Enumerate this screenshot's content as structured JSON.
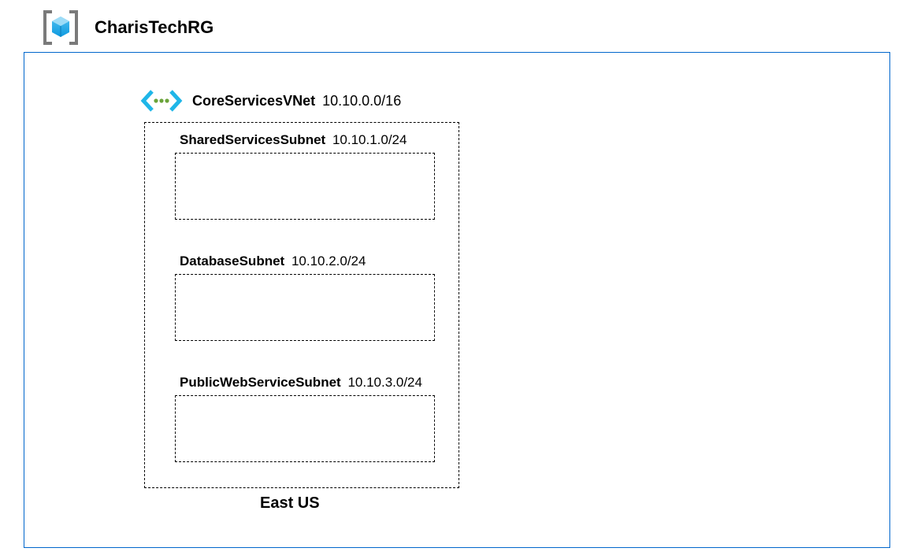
{
  "resourceGroup": {
    "name": "CharisTechRG"
  },
  "vnet": {
    "name": "CoreServicesVNet",
    "cidr": "10.10.0.0/16",
    "region": "East US"
  },
  "subnets": [
    {
      "name": "SharedServicesSubnet",
      "cidr": "10.10.1.0/24"
    },
    {
      "name": "DatabaseSubnet",
      "cidr": "10.10.2.0/24"
    },
    {
      "name": "PublicWebServiceSubnet",
      "cidr": "10.10.3.0/24"
    }
  ]
}
